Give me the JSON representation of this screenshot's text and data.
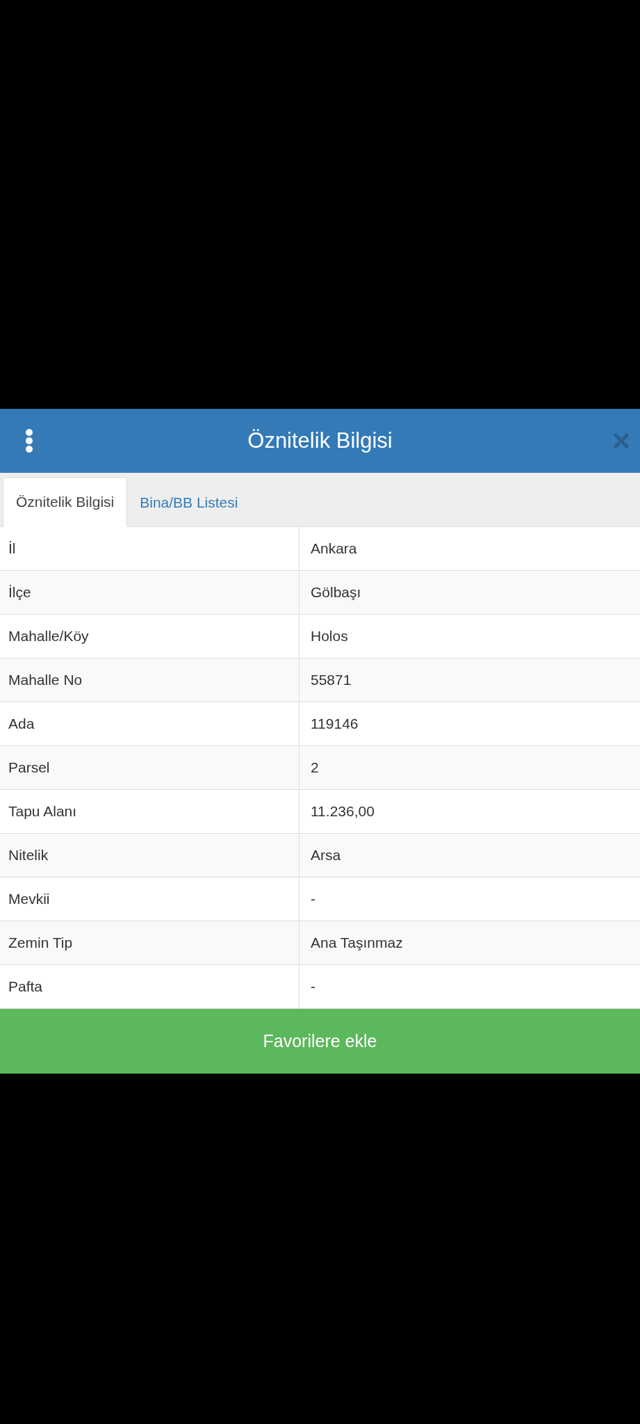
{
  "header": {
    "title": "Öznitelik Bilgisi"
  },
  "tabs": [
    {
      "label": "Öznitelik Bilgisi",
      "selected": true
    },
    {
      "label": "Bina/BB Listesi",
      "selected": false
    }
  ],
  "table": {
    "rows": [
      {
        "label": "İl",
        "value": "Ankara"
      },
      {
        "label": "İlçe",
        "value": "Gölbaşı"
      },
      {
        "label": "Mahalle/Köy",
        "value": "Holos"
      },
      {
        "label": "Mahalle No",
        "value": "55871"
      },
      {
        "label": "Ada",
        "value": "119146"
      },
      {
        "label": "Parsel",
        "value": "2"
      },
      {
        "label": "Tapu Alanı",
        "value": "11.236,00"
      },
      {
        "label": "Nitelik",
        "value": "Arsa"
      },
      {
        "label": "Mevkii",
        "value": "-"
      },
      {
        "label": "Zemin Tip",
        "value": "Ana Taşınmaz"
      },
      {
        "label": "Pafta",
        "value": "-"
      }
    ]
  },
  "button": {
    "label": "Favorilere ekle"
  }
}
